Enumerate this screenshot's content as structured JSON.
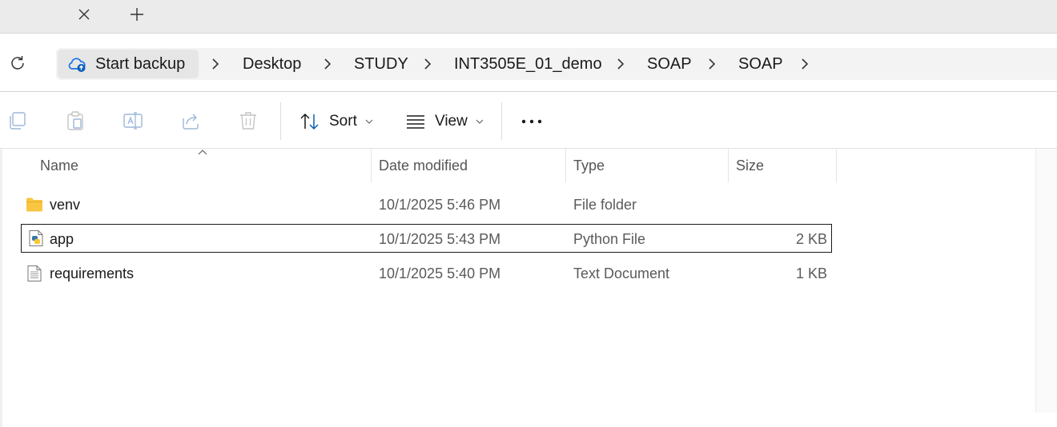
{
  "tabs": {
    "close_icon": "close-icon",
    "new_tab_icon": "plus-icon"
  },
  "address": {
    "refresh_icon": "refresh-icon",
    "backup_label": "Start backup",
    "crumbs": [
      "Desktop",
      "STUDY",
      "INT3505E_01_demo",
      "SOAP",
      "SOAP"
    ]
  },
  "toolbar": {
    "icons": [
      "copy-icon",
      "paste-icon",
      "rename-icon",
      "share-icon",
      "delete-icon"
    ],
    "sort_label": "Sort",
    "view_label": "View",
    "more_icon": "more-icon"
  },
  "columns": {
    "name": "Name",
    "date": "Date modified",
    "type": "Type",
    "size": "Size"
  },
  "files": [
    {
      "name": "venv",
      "date": "10/1/2025 5:46 PM",
      "type": "File folder",
      "size": "",
      "icon": "folder-icon"
    },
    {
      "name": "app",
      "date": "10/1/2025 5:43 PM",
      "type": "Python File",
      "size": "2 KB",
      "icon": "python-file-icon"
    },
    {
      "name": "requirements",
      "date": "10/1/2025 5:40 PM",
      "type": "Text Document",
      "size": "1 KB",
      "icon": "text-file-icon"
    }
  ],
  "colors": {
    "folder": "#f8c640",
    "accent": "#0a5fb5"
  }
}
